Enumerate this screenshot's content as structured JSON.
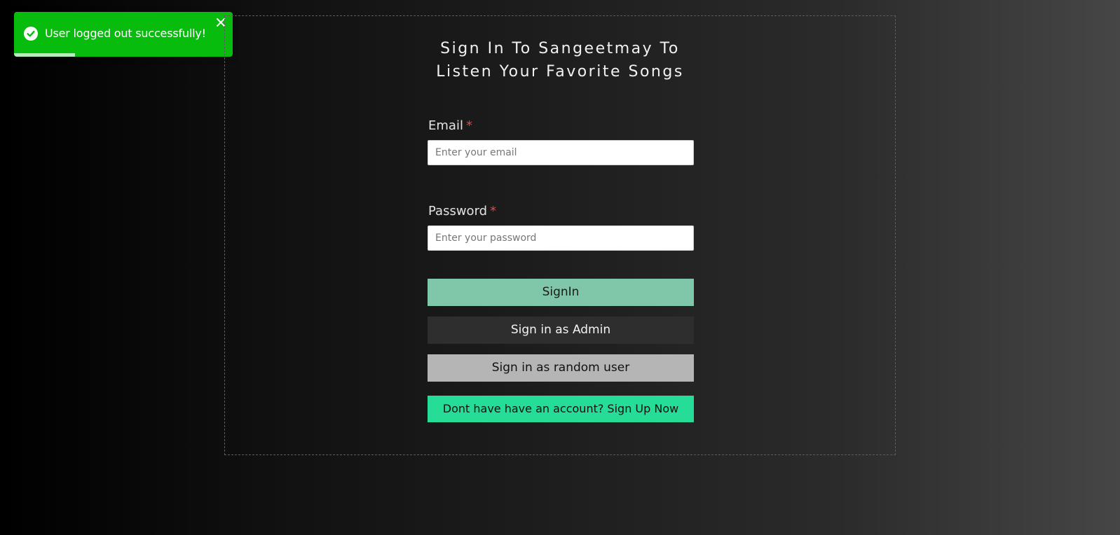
{
  "toast": {
    "message": "User logged out successfully!",
    "icon": "check-circle-icon",
    "close_icon": "close-icon",
    "progress": 0.28,
    "color": "#07bc0c"
  },
  "heading": {
    "line1": "Sign In To Sangeetmay To",
    "line2": "Listen Your Favorite Songs"
  },
  "form": {
    "email": {
      "label": "Email",
      "required_mark": "*",
      "placeholder": "Enter your email",
      "value": ""
    },
    "password": {
      "label": "Password",
      "required_mark": "*",
      "placeholder": "Enter your password",
      "value": ""
    }
  },
  "buttons": {
    "signin": "SignIn",
    "admin": "Sign in as Admin",
    "random": "Sign in as random user",
    "signup": "Dont have have an account? Sign Up Now"
  },
  "colors": {
    "signin_bg": "#7fc7a8",
    "admin_bg": "#2e2e2e",
    "random_bg": "#b5b5b5",
    "signup_bg": "#26dd97",
    "required": "#e04848"
  }
}
